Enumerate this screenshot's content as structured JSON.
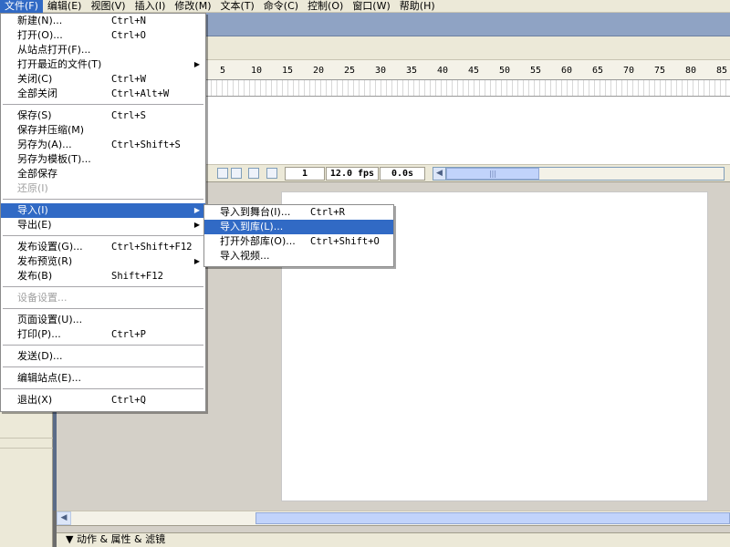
{
  "menubar": {
    "items": [
      {
        "label": "文件(F)"
      },
      {
        "label": "编辑(E)"
      },
      {
        "label": "视图(V)"
      },
      {
        "label": "插入(I)"
      },
      {
        "label": "修改(M)"
      },
      {
        "label": "文本(T)"
      },
      {
        "label": "命令(C)"
      },
      {
        "label": "控制(O)"
      },
      {
        "label": "窗口(W)"
      },
      {
        "label": "帮助(H)"
      }
    ]
  },
  "file_menu": {
    "items": [
      {
        "label": "新建(N)...",
        "shortcut": "Ctrl+N"
      },
      {
        "label": "打开(O)...",
        "shortcut": "Ctrl+O"
      },
      {
        "label": "从站点打开(F)...",
        "shortcut": ""
      },
      {
        "label": "打开最近的文件(T)",
        "shortcut": ""
      },
      {
        "label": "关闭(C)",
        "shortcut": "Ctrl+W"
      },
      {
        "label": "全部关闭",
        "shortcut": "Ctrl+Alt+W"
      },
      {
        "label": "保存(S)",
        "shortcut": "Ctrl+S"
      },
      {
        "label": "保存并压缩(M)",
        "shortcut": ""
      },
      {
        "label": "另存为(A)...",
        "shortcut": "Ctrl+Shift+S"
      },
      {
        "label": "另存为模板(T)...",
        "shortcut": ""
      },
      {
        "label": "全部保存",
        "shortcut": ""
      },
      {
        "label": "还原(I)",
        "shortcut": ""
      },
      {
        "label": "导入(I)",
        "shortcut": ""
      },
      {
        "label": "导出(E)",
        "shortcut": ""
      },
      {
        "label": "发布设置(G)...",
        "shortcut": "Ctrl+Shift+F12"
      },
      {
        "label": "发布预览(R)",
        "shortcut": ""
      },
      {
        "label": "发布(B)",
        "shortcut": "Shift+F12"
      },
      {
        "label": "设备设置...",
        "shortcut": ""
      },
      {
        "label": "页面设置(U)...",
        "shortcut": ""
      },
      {
        "label": "打印(P)...",
        "shortcut": "Ctrl+P"
      },
      {
        "label": "发送(D)...",
        "shortcut": ""
      },
      {
        "label": "编辑站点(E)...",
        "shortcut": ""
      },
      {
        "label": "退出(X)",
        "shortcut": "Ctrl+Q"
      }
    ]
  },
  "import_submenu": {
    "items": [
      {
        "label": "导入到舞台(I)...",
        "shortcut": "Ctrl+R"
      },
      {
        "label": "导入到库(L)...",
        "shortcut": ""
      },
      {
        "label": "打开外部库(O)...",
        "shortcut": "Ctrl+Shift+O"
      },
      {
        "label": "导入视频...",
        "shortcut": ""
      }
    ]
  },
  "timeline": {
    "ticks": [
      "5",
      "10",
      "15",
      "20",
      "25",
      "30",
      "35",
      "40",
      "45",
      "50",
      "55",
      "60",
      "65",
      "70",
      "75",
      "80",
      "85"
    ],
    "current_frame": "1",
    "frame_rate": "12.0 fps",
    "elapsed_time": "0.0s"
  },
  "panel_bar": {
    "label": "▼ 动作 & 属性 & 滤镜"
  }
}
